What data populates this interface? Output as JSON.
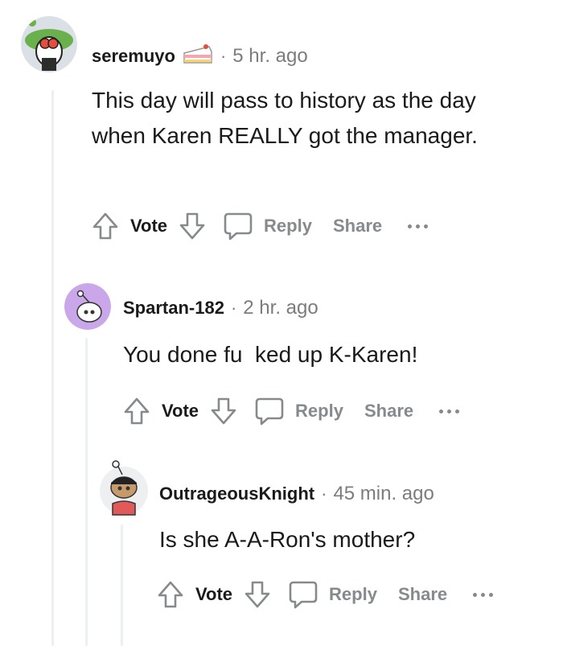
{
  "comments": [
    {
      "username": "seremuyo",
      "separator": "·",
      "time": "5 hr. ago",
      "flair_icon": "cake-icon",
      "text": "This day will pass to history as the day when Karen REALLY got the manager.",
      "actions": {
        "vote": "Vote",
        "reply": "Reply",
        "share": "Share"
      }
    },
    {
      "username": "Spartan-182",
      "separator": "·",
      "time": "2 hr. ago",
      "text": "You done fu  ked up K-Karen!",
      "actions": {
        "vote": "Vote",
        "reply": "Reply",
        "share": "Share"
      }
    },
    {
      "username": "OutrageousKnight",
      "separator": "·",
      "time": "45 min. ago",
      "text": "Is she A-A-Ron's mother?",
      "actions": {
        "vote": "Vote",
        "reply": "Reply",
        "share": "Share"
      }
    }
  ],
  "colors": {
    "text": "#1a1a1b",
    "muted": "#7c7c7c",
    "action_gray": "#878a8c",
    "thread_line": "#edeff1"
  }
}
